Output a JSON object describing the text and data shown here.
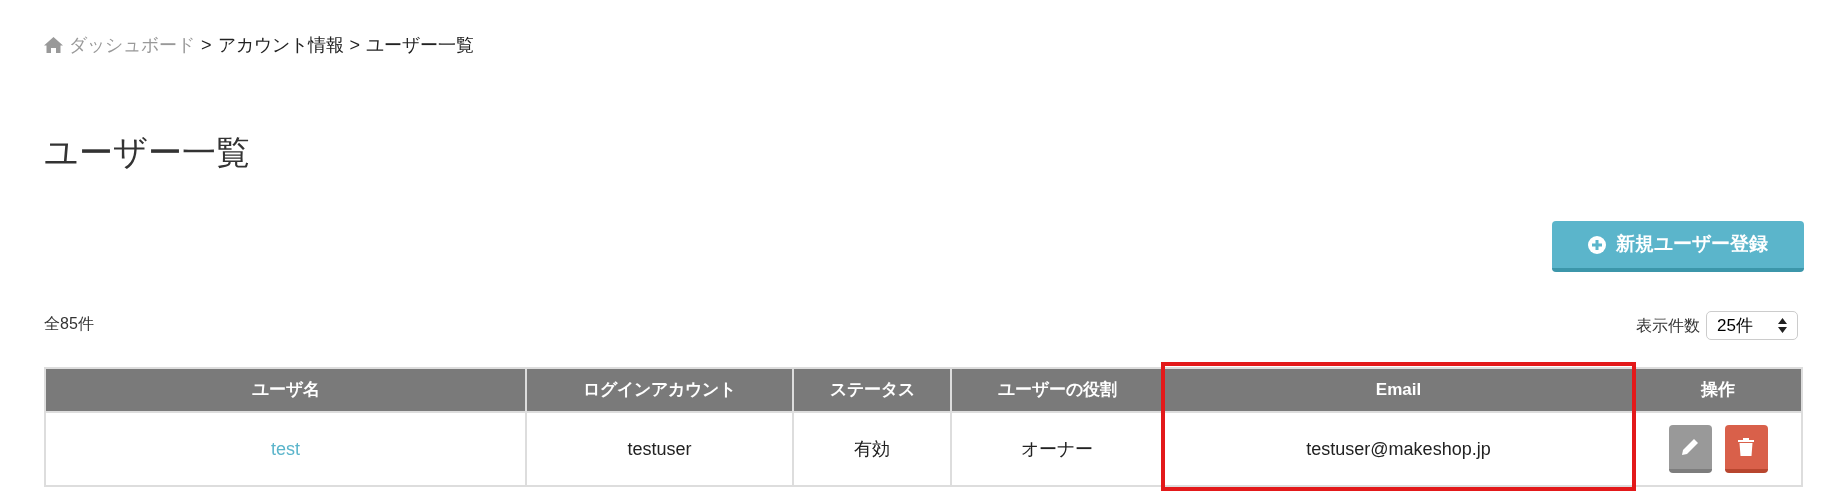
{
  "breadcrumb": [
    {
      "label": "ダッシュボード",
      "link": true
    },
    {
      "label": "アカウント情報",
      "link": false
    },
    {
      "label": "ユーザー一覧",
      "link": false
    }
  ],
  "breadcrumb_separator": ">",
  "title": "ユーザー一覧",
  "new_user_button": "新規ユーザー登録",
  "total": "全85件",
  "per_page": {
    "label": "表示件数",
    "value": "25件"
  },
  "table": {
    "columns": [
      {
        "label": "ユーザ名",
        "highlighted": false
      },
      {
        "label": "ログインアカウント",
        "highlighted": false
      },
      {
        "label": "ステータス",
        "highlighted": false
      },
      {
        "label": "ユーザーの役割",
        "highlighted": false
      },
      {
        "label": "Email",
        "highlighted": true
      },
      {
        "label": "操作",
        "highlighted": false
      }
    ],
    "rows": [
      {
        "name": "test",
        "login": "testuser",
        "status": "有効",
        "role": "オーナー",
        "email": "testuser@makeshop.jp"
      }
    ]
  }
}
